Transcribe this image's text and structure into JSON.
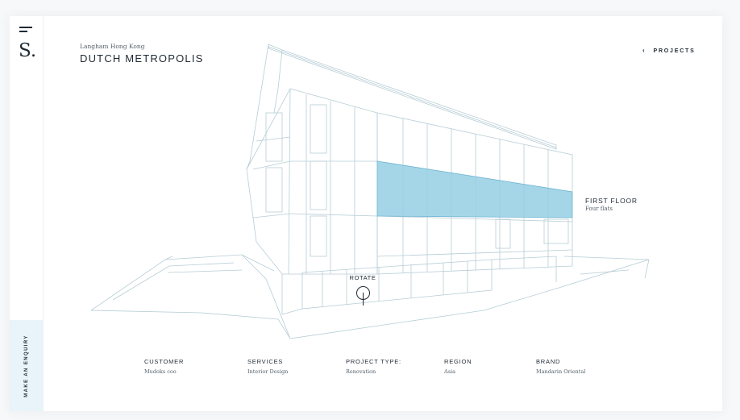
{
  "sidebar": {
    "logo": "S.",
    "enquiry_label": "MAKE AN ENQUIRY"
  },
  "header": {
    "subtitle": "Langham Hong Kong",
    "title": "DUTCH METROPOLIS",
    "back_icon": "‹",
    "projects_label": "PROJECTS"
  },
  "floor": {
    "title": "FIRST FLOOR",
    "subtitle": "Four flats"
  },
  "rotate": {
    "label": "ROTATE"
  },
  "info": {
    "items": [
      {
        "label": "CUSTOMER",
        "value": "Mudoks coo"
      },
      {
        "label": "SERVICES",
        "value": "Interior Design"
      },
      {
        "label": "PROJECT TYPE:",
        "value": "Renovation"
      },
      {
        "label": "REGION",
        "value": "Asia"
      },
      {
        "label": "BRAND",
        "value": "Mandarin Oriental"
      }
    ]
  },
  "colors": {
    "line": "#b7cdd6",
    "highlight": "#7fc4de",
    "accent_bg": "#e8f4f9",
    "text": "#1f2a33"
  }
}
